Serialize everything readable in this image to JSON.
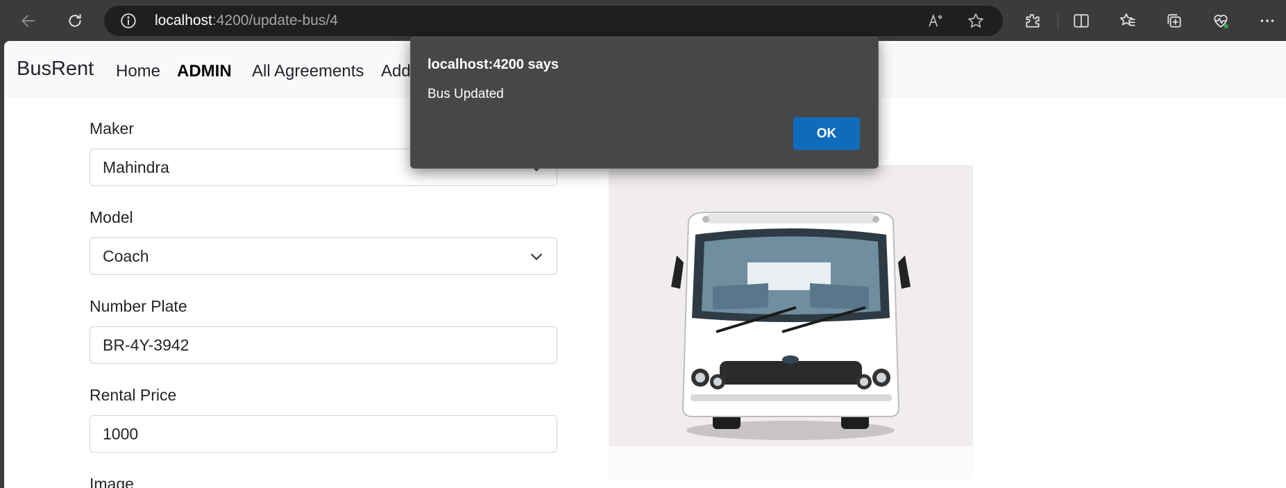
{
  "browser": {
    "url_host": "localhost",
    "url_rest": ":4200/update-bus/4"
  },
  "navbar": {
    "brand": "BusRent",
    "links": [
      "Home",
      "ADMIN",
      "All Agreements",
      "Add"
    ]
  },
  "form": {
    "maker": {
      "label": "Maker",
      "value": "Mahindra"
    },
    "model": {
      "label": "Model",
      "value": "Coach"
    },
    "number_plate": {
      "label": "Number Plate",
      "value": "BR-4Y-3942"
    },
    "rental_price": {
      "label": "Rental Price",
      "value": "1000"
    },
    "image": {
      "label": "Image"
    }
  },
  "alert": {
    "title": "localhost:4200 says",
    "message": "Bus Updated",
    "ok_label": "OK"
  },
  "icons": {
    "back": "back-arrow-icon",
    "refresh": "refresh-icon",
    "info": "info-icon",
    "read_aloud": "read-aloud-icon",
    "favorite": "star-icon",
    "extensions": "puzzle-icon",
    "split_screen": "split-screen-icon",
    "favorites_bar": "favorites-icon",
    "collections": "collections-icon",
    "performance": "heartbeat-icon",
    "more": "more-icon"
  }
}
